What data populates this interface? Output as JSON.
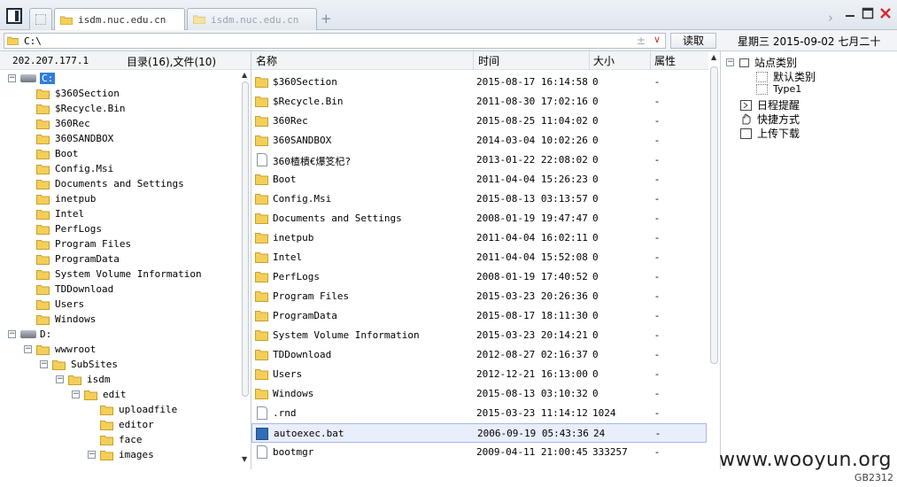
{
  "tabs": [
    {
      "label": "isdm.nuc.edu.cn",
      "active": true
    },
    {
      "label": "isdm.nuc.edu.cn",
      "active": false
    }
  ],
  "new_tab_symbol": "+",
  "address": {
    "value": "C:\\",
    "read_button": "读取"
  },
  "date_label": "星期三 2015-09-02 七月二十",
  "left_pane": {
    "ip": "202.207.177.1",
    "dir_info": "目录(16),文件(10)",
    "tree": [
      {
        "label": "C:",
        "type": "drive",
        "depth": 0,
        "expanded": true,
        "selected": true
      },
      {
        "label": "$360Section",
        "type": "folder",
        "depth": 1
      },
      {
        "label": "$Recycle.Bin",
        "type": "folder",
        "depth": 1
      },
      {
        "label": "360Rec",
        "type": "folder",
        "depth": 1
      },
      {
        "label": "360SANDBOX",
        "type": "folder",
        "depth": 1
      },
      {
        "label": "Boot",
        "type": "folder",
        "depth": 1
      },
      {
        "label": "Config.Msi",
        "type": "folder",
        "depth": 1
      },
      {
        "label": "Documents and Settings",
        "type": "folder",
        "depth": 1
      },
      {
        "label": "inetpub",
        "type": "folder",
        "depth": 1
      },
      {
        "label": "Intel",
        "type": "folder",
        "depth": 1
      },
      {
        "label": "PerfLogs",
        "type": "folder",
        "depth": 1
      },
      {
        "label": "Program Files",
        "type": "folder",
        "depth": 1
      },
      {
        "label": "ProgramData",
        "type": "folder",
        "depth": 1
      },
      {
        "label": "System Volume Information",
        "type": "folder",
        "depth": 1
      },
      {
        "label": "TDDownload",
        "type": "folder",
        "depth": 1
      },
      {
        "label": "Users",
        "type": "folder",
        "depth": 1
      },
      {
        "label": "Windows",
        "type": "folder",
        "depth": 1
      },
      {
        "label": "D:",
        "type": "drive",
        "depth": 0,
        "expanded": true
      },
      {
        "label": "wwwroot",
        "type": "folder",
        "depth": 1,
        "expanded": true
      },
      {
        "label": "SubSites",
        "type": "folder",
        "depth": 2,
        "expanded": true
      },
      {
        "label": "isdm",
        "type": "folder",
        "depth": 3,
        "expanded": true
      },
      {
        "label": "edit",
        "type": "folder",
        "depth": 4,
        "expanded": true
      },
      {
        "label": "uploadfile",
        "type": "folder",
        "depth": 5
      },
      {
        "label": "editor",
        "type": "folder",
        "depth": 5
      },
      {
        "label": "face",
        "type": "folder",
        "depth": 5
      },
      {
        "label": "images",
        "type": "folder",
        "depth": 5,
        "expanded": true
      }
    ]
  },
  "file_list": {
    "columns": [
      "名称",
      "时间",
      "大小",
      "属性"
    ],
    "rows": [
      {
        "name": "$360Section",
        "type": "folder",
        "time": "2015-08-17 16:14:58",
        "size": "0",
        "attr": "-"
      },
      {
        "name": "$Recycle.Bin",
        "type": "folder",
        "time": "2011-08-30 17:02:16",
        "size": "0",
        "attr": "-"
      },
      {
        "name": "360Rec",
        "type": "folder",
        "time": "2015-08-25 11:04:02",
        "size": "0",
        "attr": "-"
      },
      {
        "name": "360SANDBOX",
        "type": "folder",
        "time": "2014-03-04 10:02:26",
        "size": "0",
        "attr": "-"
      },
      {
        "name": "360楂樻€爆笅杞?",
        "type": "file",
        "time": "2013-01-22 22:08:02",
        "size": "0",
        "attr": "-"
      },
      {
        "name": "Boot",
        "type": "folder",
        "time": "2011-04-04 15:26:23",
        "size": "0",
        "attr": "-"
      },
      {
        "name": "Config.Msi",
        "type": "folder",
        "time": "2015-08-13 03:13:57",
        "size": "0",
        "attr": "-"
      },
      {
        "name": "Documents and Settings",
        "type": "folder",
        "time": "2008-01-19 19:47:47",
        "size": "0",
        "attr": "-"
      },
      {
        "name": "inetpub",
        "type": "folder",
        "time": "2011-04-04 16:02:11",
        "size": "0",
        "attr": "-"
      },
      {
        "name": "Intel",
        "type": "folder",
        "time": "2011-04-04 15:52:08",
        "size": "0",
        "attr": "-"
      },
      {
        "name": "PerfLogs",
        "type": "folder",
        "time": "2008-01-19 17:40:52",
        "size": "0",
        "attr": "-"
      },
      {
        "name": "Program Files",
        "type": "folder",
        "time": "2015-03-23 20:26:36",
        "size": "0",
        "attr": "-"
      },
      {
        "name": "ProgramData",
        "type": "folder",
        "time": "2015-08-17 18:11:30",
        "size": "0",
        "attr": "-"
      },
      {
        "name": "System Volume Information",
        "type": "folder",
        "time": "2015-03-23 20:14:21",
        "size": "0",
        "attr": "-"
      },
      {
        "name": "TDDownload",
        "type": "folder",
        "time": "2012-08-27 02:16:37",
        "size": "0",
        "attr": "-"
      },
      {
        "name": "Users",
        "type": "folder",
        "time": "2012-12-21 16:13:00",
        "size": "0",
        "attr": "-"
      },
      {
        "name": "Windows",
        "type": "folder",
        "time": "2015-08-13 03:10:32",
        "size": "0",
        "attr": "-"
      },
      {
        "name": ".rnd",
        "type": "file",
        "time": "2015-03-23 11:14:12",
        "size": "1024",
        "attr": "-"
      },
      {
        "name": "autoexec.bat",
        "type": "bat",
        "time": "2006-09-19 05:43:36",
        "size": "24",
        "attr": "-",
        "selected": true
      },
      {
        "name": "bootmgr",
        "type": "file",
        "time": "2009-04-11 21:00:45",
        "size": "333257",
        "attr": "-"
      }
    ]
  },
  "right_pane": {
    "root": "站点类别",
    "children": [
      "默认类别",
      "Type1"
    ],
    "items": [
      "日程提醒",
      "快捷方式",
      "上传下载"
    ]
  },
  "watermark": "www.wooyun.org",
  "encoding": "GB2312",
  "colors": {
    "folder": "#f3cf5a",
    "folder_edge": "#c9a02a",
    "selection": "#2f7fd8",
    "close": "#d22b2b"
  }
}
